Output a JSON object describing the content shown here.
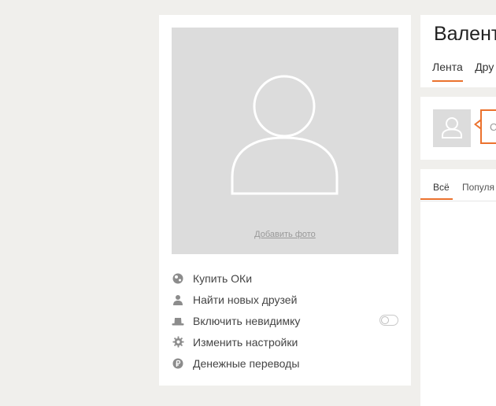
{
  "sidebar": {
    "add_photo": "Добавить фото",
    "menu": [
      {
        "label": "Купить ОКи",
        "icon": "ok-coins-icon"
      },
      {
        "label": "Найти новых друзей",
        "icon": "person-icon"
      },
      {
        "label": "Включить невидимку",
        "icon": "hat-icon",
        "toggle": false
      },
      {
        "label": "Изменить настройки",
        "icon": "gear-icon"
      },
      {
        "label": "Денежные переводы",
        "icon": "ruble-icon"
      }
    ]
  },
  "profile": {
    "name": "Валент",
    "tabs": [
      {
        "label": "Лента",
        "active": true
      },
      {
        "label": "Дру",
        "active": false
      }
    ]
  },
  "post": {
    "placeholder": "С"
  },
  "feed": {
    "tabs": [
      {
        "label": "Всё",
        "active": true
      },
      {
        "label": "Популя",
        "active": false
      }
    ]
  },
  "colors": {
    "accent": "#eb722e",
    "page_bg": "#f0efec",
    "placeholder_bg": "#dcdcdc"
  }
}
